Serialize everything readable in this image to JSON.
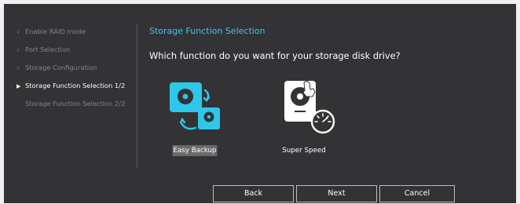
{
  "sidebar": {
    "steps": [
      {
        "label": "Enable RAID mode",
        "state": "done",
        "marker": "√"
      },
      {
        "label": "Port Selection",
        "state": "done",
        "marker": "√"
      },
      {
        "label": "Storage Configuration",
        "state": "done",
        "marker": "√"
      },
      {
        "label": "Storage Function Selection 1/2",
        "state": "active",
        "marker": "▶"
      },
      {
        "label": "Storage Function Selection 2/2",
        "state": "pending",
        "marker": ""
      }
    ]
  },
  "main": {
    "title": "Storage Function Selection",
    "question": "Which function do you want for your storage disk drive?",
    "options": [
      {
        "label": "Easy Backup",
        "icon": "easy-backup-icon",
        "selected": true
      },
      {
        "label": "Super Speed",
        "icon": "super-speed-icon",
        "selected": false
      }
    ]
  },
  "buttons": {
    "back": "Back",
    "next": "Next",
    "cancel": "Cancel"
  },
  "colors": {
    "accent": "#41c6e6",
    "background": "#333335",
    "selection": "#6a6a6a"
  }
}
